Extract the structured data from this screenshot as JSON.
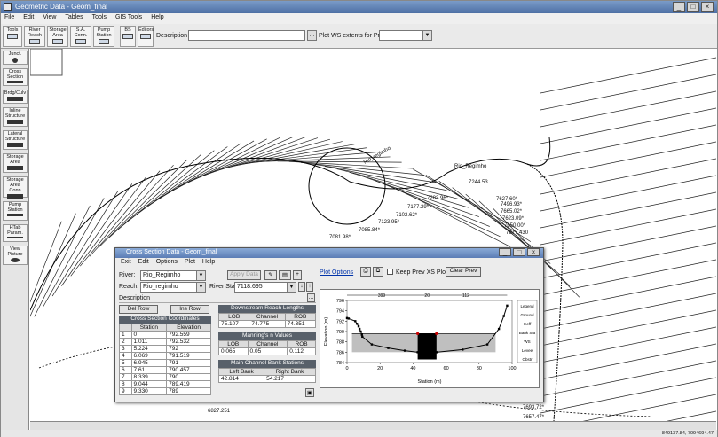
{
  "window": {
    "title": "Geometric Data - Geom_final"
  },
  "menu": [
    "File",
    "Edit",
    "View",
    "Tables",
    "Tools",
    "GIS Tools",
    "Help"
  ],
  "toolbar": {
    "tools": [
      {
        "label": "Tools",
        "name": "tools"
      },
      {
        "label": "River Reach",
        "name": "river-reach"
      },
      {
        "label": "Storage Area",
        "name": "storage-area"
      },
      {
        "label": "S.A. Conn.",
        "name": "sa-conn"
      },
      {
        "label": "Pump Station",
        "name": "pump-station"
      },
      {
        "label": "BS",
        "name": "bs"
      }
    ],
    "editors_label": "Editors",
    "description_label": "Description :",
    "description_value": "",
    "plot_ws_label": "Plot WS extents for Profile:",
    "profile_value": ""
  },
  "palette": [
    {
      "label": "Junct.",
      "name": "junction"
    },
    {
      "label": "Cross Section",
      "name": "cross-section"
    },
    {
      "label": "Brdg/Culv",
      "name": "bridge-culvert"
    },
    {
      "label": "Inline Structure",
      "name": "inline-structure"
    },
    {
      "label": "Lateral Structure",
      "name": "lateral-structure"
    },
    {
      "label": "Storage Area",
      "name": "storage-area-editor"
    },
    {
      "label": "Storage Area Conn",
      "name": "storage-area-conn"
    },
    {
      "label": "Pump Station",
      "name": "pump-station-editor"
    },
    {
      "label": "HTab Param.",
      "name": "htab-param"
    },
    {
      "label": "View Picture",
      "name": "view-picture"
    }
  ],
  "map": {
    "river_label_main": "Rio_Regimho",
    "river_label_trib": "Rio_regimho",
    "stations": [
      "7283.96*",
      "7244.53",
      "7177.29*",
      "7102.62*",
      "7123.95*",
      "7085.84*",
      "7081.98*",
      "7496.93*",
      "7665.02*",
      "7623.09*",
      "7650.00*",
      "7677.430",
      "6827.251",
      "7693.72*",
      "7657.47*",
      "7627.60*"
    ]
  },
  "dialog": {
    "title": "Cross Section Data - Geom_final",
    "menu": [
      "Exit",
      "Edit",
      "Options",
      "Plot",
      "Help"
    ],
    "river_label": "River:",
    "river_value": "Rio_Regimho",
    "reach_label": "Reach:",
    "reach_value": "Rio_regimho",
    "river_sta_label": "River Sta.:",
    "river_sta_value": "7118.695",
    "apply_label": "Apply Data",
    "description_label": "Description",
    "del_row": "Del Row",
    "ins_row": "Ins Row",
    "coord_header": "Cross Section Coordinates",
    "coord_cols": [
      "",
      "Station",
      "Elevation"
    ],
    "coords": [
      [
        "1",
        "0",
        "792.559"
      ],
      [
        "2",
        "1.011",
        "792.532"
      ],
      [
        "3",
        "5.224",
        "792"
      ],
      [
        "4",
        "6.069",
        "791.519"
      ],
      [
        "5",
        "6.945",
        "791"
      ],
      [
        "6",
        "7.61",
        "790.457"
      ],
      [
        "7",
        "8.339",
        "790"
      ],
      [
        "8",
        "9.044",
        "789.419"
      ],
      [
        "9",
        "9.330",
        "789"
      ]
    ],
    "reach_len_header": "Downstream Reach Lengths",
    "reach_cols": [
      "LOB",
      "Channel",
      "ROB"
    ],
    "reach_vals": [
      "75.107",
      "74.775",
      "74.351"
    ],
    "manning_header": "Manning's n Values",
    "manning_cols": [
      "LOB",
      "Channel",
      "ROB"
    ],
    "manning_vals": [
      "0.065",
      "0.05",
      "0.112"
    ],
    "bank_header": "Main Channel Bank Stations",
    "bank_cols": [
      "Left Bank",
      "Right Bank"
    ],
    "bank_vals": [
      "42.814",
      "54.217"
    ],
    "plot_options": "Plot Options",
    "keep_prev": "Keep Prev XS Plots",
    "clear_prev": "Clear Prev"
  },
  "chart_data": {
    "type": "line",
    "title": "",
    "xlabel": "Station (m)",
    "ylabel": "Elevation (m)",
    "xlim": [
      0,
      100
    ],
    "ylim": [
      784,
      796
    ],
    "x_ticks": [
      "0",
      "20",
      "40",
      "60",
      "80",
      "100"
    ],
    "y_ticks": [
      "784",
      "786",
      "788",
      "790",
      "792",
      "794",
      "796"
    ],
    "top_dims": [
      "399",
      "20",
      "112"
    ],
    "series": [
      {
        "name": "Ground",
        "x": [
          0,
          1,
          5,
          6,
          7,
          7.6,
          8.3,
          9,
          9.3,
          15,
          25,
          35,
          42.8,
          48.5,
          54.2,
          70,
          85,
          92,
          95,
          97
        ],
        "y": [
          792.6,
          792.5,
          792,
          791.5,
          791,
          790.5,
          790,
          789.4,
          789,
          787.5,
          786.8,
          786.3,
          786,
          785.3,
          786,
          786.5,
          787.5,
          790.5,
          793,
          795
        ]
      },
      {
        "name": "Bank Sta",
        "x": [
          42.8,
          54.2
        ],
        "y": [
          789.6,
          789.6
        ]
      }
    ],
    "legend": [
      "Legend",
      "Ground",
      "Ineff",
      "Bank Sta",
      "WS",
      "Levee",
      "Obstr"
    ],
    "colors": {
      "ground": "#000000",
      "water": "#bfbfbf",
      "obstruction": "#000000"
    }
  },
  "status": {
    "coords": "849137.84, 7094694.47"
  }
}
